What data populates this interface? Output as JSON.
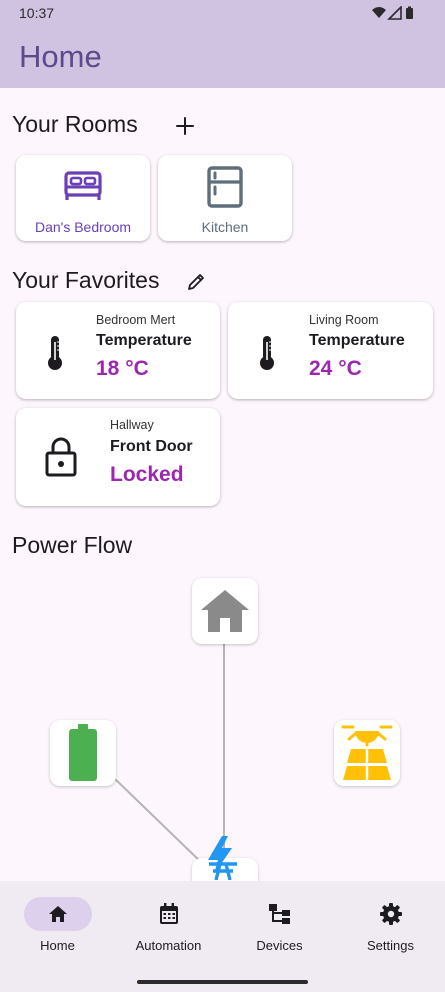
{
  "status_bar": {
    "time": "10:37"
  },
  "app_bar": {
    "title": "Home"
  },
  "rooms": {
    "title": "Your Rooms",
    "items": [
      {
        "label": "Dan's Bedroom",
        "icon": "bed-icon"
      },
      {
        "label": "Kitchen",
        "icon": "fridge-icon"
      }
    ]
  },
  "favorites": {
    "title": "Your Favorites",
    "items": [
      {
        "room": "Bedroom Mert",
        "name": "Temperature",
        "value": "18 °C",
        "icon": "thermometer-icon"
      },
      {
        "room": "Living Room",
        "name": "Temperature",
        "value": "24 °C",
        "icon": "thermometer-icon"
      },
      {
        "room": "Hallway",
        "name": "Front Door",
        "value": "Locked",
        "icon": "lock-icon"
      }
    ]
  },
  "power_flow": {
    "title": "Power Flow",
    "nodes": [
      "home-icon",
      "battery-icon",
      "solar-panel-icon",
      "grid-icon"
    ]
  },
  "nav": {
    "items": [
      {
        "label": "Home",
        "icon": "home-icon",
        "active": true
      },
      {
        "label": "Automation",
        "icon": "calendar-icon",
        "active": false
      },
      {
        "label": "Devices",
        "icon": "devices-tree-icon",
        "active": false
      },
      {
        "label": "Settings",
        "icon": "gear-icon",
        "active": false
      }
    ]
  },
  "colors": {
    "app_bar": "#cfc3e1",
    "title": "#5b4a8c",
    "accent_value": "#9c27b0",
    "room_active": "#6a3fb8",
    "room_muted": "#5d6e7c",
    "battery": "#4caf50",
    "solar": "#ffc107",
    "grid": "#2196f3",
    "home_node": "#8a8a8a"
  }
}
